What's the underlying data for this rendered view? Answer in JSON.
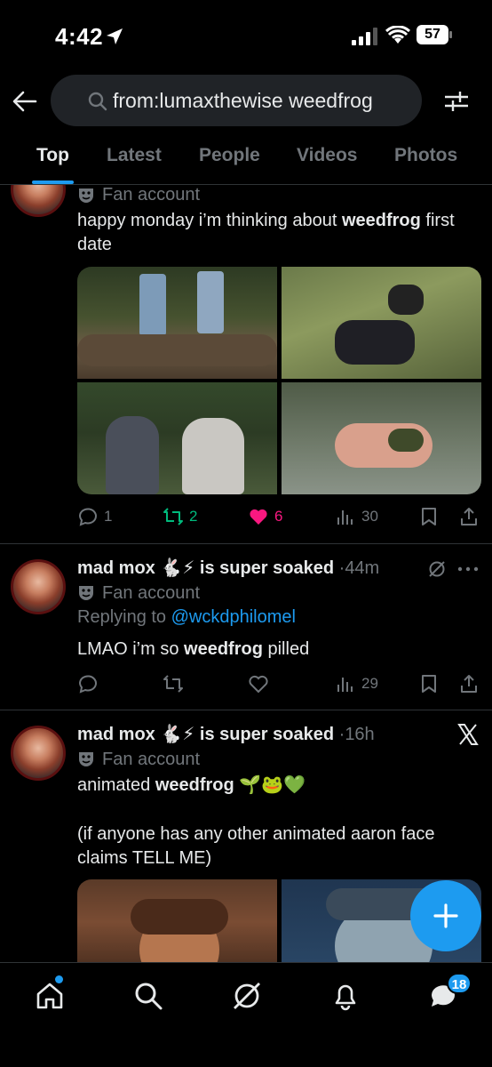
{
  "status_bar": {
    "time": "4:42",
    "battery": "57"
  },
  "search": {
    "query": "from:lumaxthewise weedfrog"
  },
  "tabs": [
    {
      "label": "Top",
      "active": true
    },
    {
      "label": "Latest"
    },
    {
      "label": "People"
    },
    {
      "label": "Videos"
    },
    {
      "label": "Photos"
    }
  ],
  "tweets": [
    {
      "fan_label": "Fan account",
      "text_pre": "happy monday i’m thinking about ",
      "text_bold": "weedfrog",
      "text_post": " first date",
      "replies": "1",
      "retweets": "2",
      "likes": "6",
      "views": "30"
    },
    {
      "author": "mad mox",
      "author_suffix": "is super soaked",
      "time": "44m",
      "fan_label": "Fan account",
      "reply_prefix": "Replying to ",
      "reply_handle": "@wckdphilomel",
      "text_pre": "LMAO i’m so ",
      "text_bold": "weedfrog",
      "text_post": " pilled",
      "views": "29"
    },
    {
      "author": "mad mox",
      "author_suffix": "is super soaked",
      "time": "16h",
      "fan_label": "Fan account",
      "text_pre": "animated ",
      "text_bold": "weedfrog",
      "text_emoji": "🌱🐸💚",
      "text_line2": "(if anyone has any other animated aaron face claims TELL ME)"
    }
  ],
  "messages_badge": "18",
  "colors": {
    "accent": "#1d9bf0",
    "like": "#f91880",
    "retweet": "#00ba7c",
    "muted": "#71767b"
  }
}
